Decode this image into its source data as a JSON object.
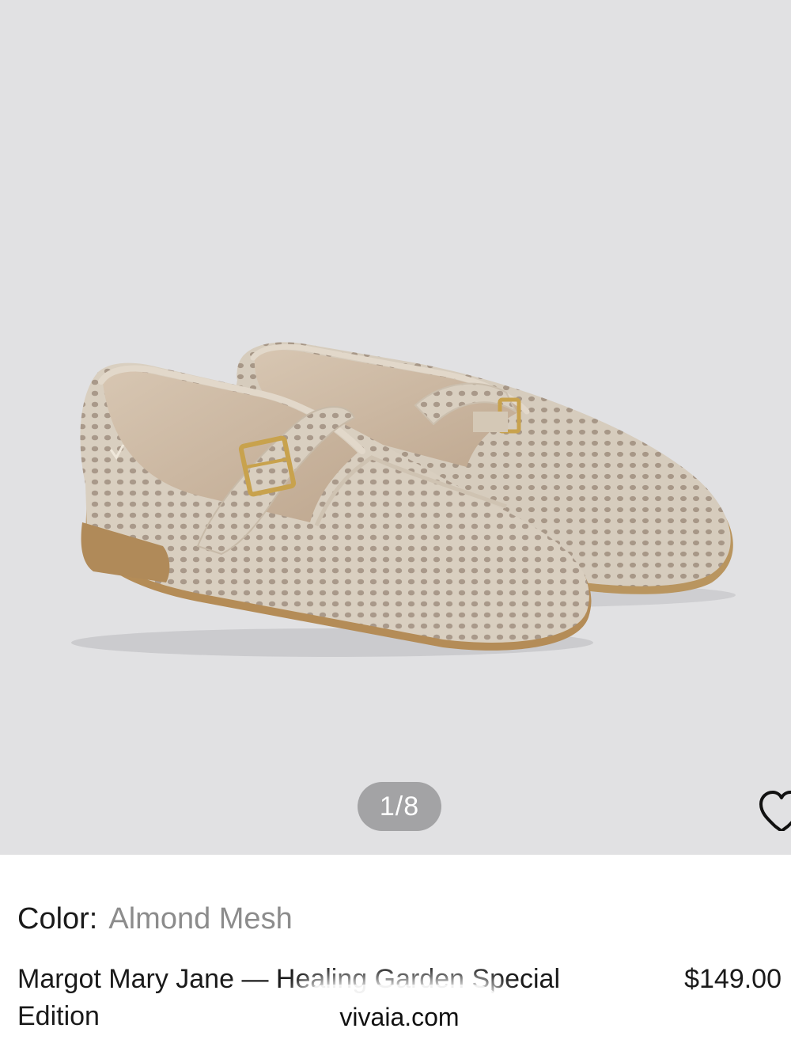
{
  "gallery": {
    "counter": "1/8",
    "current_index": 1,
    "total_images": 8,
    "background_color": "#e1e1e3",
    "image_subject": "pair of almond knit mesh mary jane flats with gold buckle"
  },
  "wishlist": {
    "icon": "heart-outline-icon"
  },
  "product": {
    "color_label": "Color:",
    "color_value": "Almond Mesh",
    "title": "Margot Mary Jane — Healing Garden Special Edition",
    "price": "$149.00"
  },
  "browser": {
    "url": "vivaia.com"
  },
  "colors": {
    "shoe_knit": "#d8cebf",
    "sole": "#b08a59",
    "buckle": "#c8a24d",
    "text_primary": "#1a1a1a",
    "text_secondary": "#8c8c8c"
  }
}
